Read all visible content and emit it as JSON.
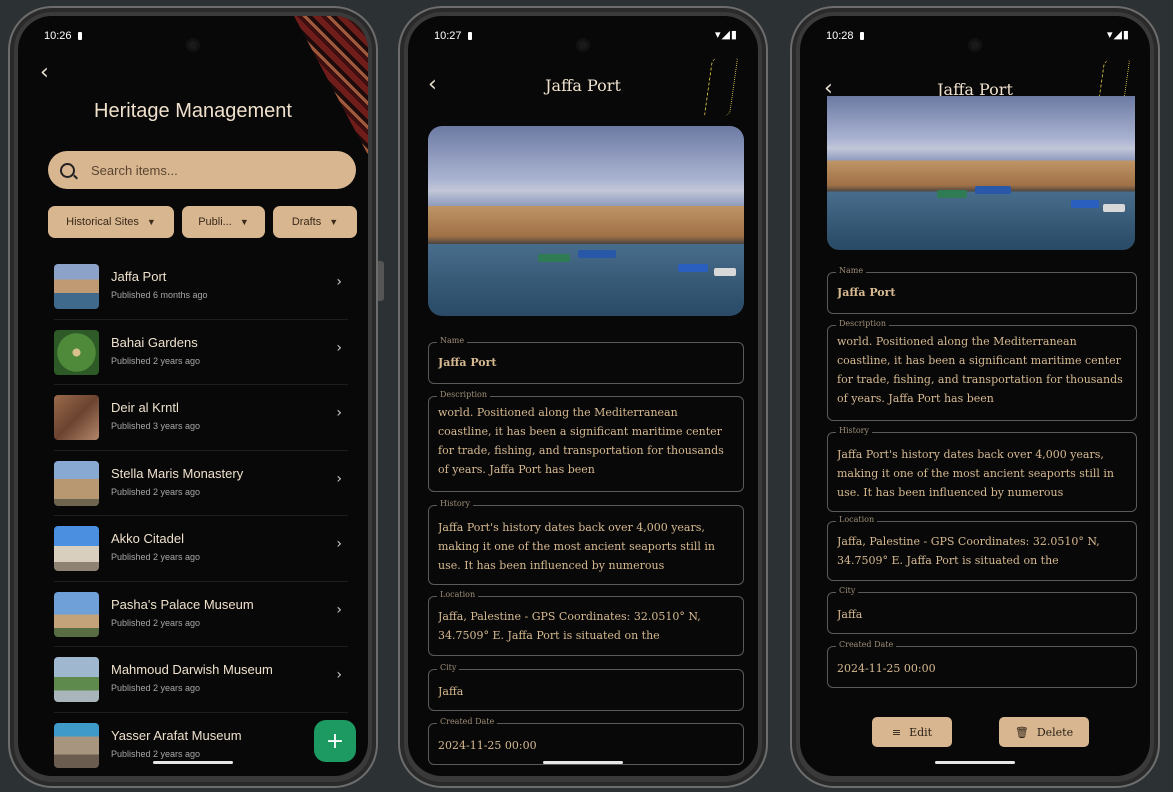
{
  "screen1": {
    "time": "10:26",
    "status_icons": "▾◢▮",
    "title": "Heritage Management",
    "search_placeholder": "Search items...",
    "filters": [
      "Historical Sites",
      "Publi...",
      "Drafts"
    ],
    "items": [
      {
        "name": "Jaffa Port",
        "sub": "Published 6 months ago"
      },
      {
        "name": "Bahai Gardens",
        "sub": "Published 2 years ago"
      },
      {
        "name": "Deir al Krntl",
        "sub": "Published 3 years ago"
      },
      {
        "name": "Stella Maris Monastery",
        "sub": "Published 2 years ago"
      },
      {
        "name": "Akko Citadel",
        "sub": "Published 2 years ago"
      },
      {
        "name": "Pasha's Palace Museum",
        "sub": "Published 2 years ago"
      },
      {
        "name": "Mahmoud Darwish Museum",
        "sub": "Published 2 years ago"
      },
      {
        "name": "Yasser Arafat Museum",
        "sub": "Published 2 years ago"
      }
    ],
    "fab_label": "+"
  },
  "screen2": {
    "time": "10:27",
    "status_icons": "▾◢▮",
    "title": "Jaffa Port",
    "name_label": "Name",
    "name": "Jaffa Port",
    "description_label": "Description",
    "description": "world. Positioned along the Mediterranean coastline, it has been a significant maritime center for trade, fishing, and transportation for thousands of years. Jaffa Port has been",
    "history_label": "History",
    "history": "Jaffa Port's history dates back over 4,000 years, making it one of the most ancient seaports still in use. It has been influenced by numerous",
    "location_label": "Location",
    "location": "Jaffa, Palestine - GPS Coordinates: 32.0510° N, 34.7509° E. Jaffa Port is situated on the",
    "city_label": "City",
    "city": "Jaffa",
    "created_label": "Created Date",
    "created": "2024-11-25 00:00"
  },
  "screen3": {
    "time": "10:28",
    "status_icons": "▾◢▮",
    "title": "Jaffa Port",
    "name_label": "Name",
    "name": "Jaffa Port",
    "description_label": "Description",
    "description": "world. Positioned along the Mediterranean coastline, it has been a significant maritime center for trade, fishing, and transportation for thousands of years. Jaffa Port has been",
    "history_label": "History",
    "history": "Jaffa Port's history dates back over 4,000 years, making it one of the most ancient seaports still in use. It has been influenced by numerous",
    "location_label": "Location",
    "location": "Jaffa, Palestine - GPS Coordinates: 32.0510° N, 34.7509° E. Jaffa Port is situated on the",
    "city_label": "City",
    "city": "Jaffa",
    "created_label": "Created Date",
    "created": "2024-11-25 00:00",
    "edit_label": "Edit",
    "delete_label": "Delete"
  },
  "colors": {
    "accent": "#d8b690",
    "fab": "#1d9a62",
    "background": "#080808",
    "text_gold": "#d6b991"
  }
}
